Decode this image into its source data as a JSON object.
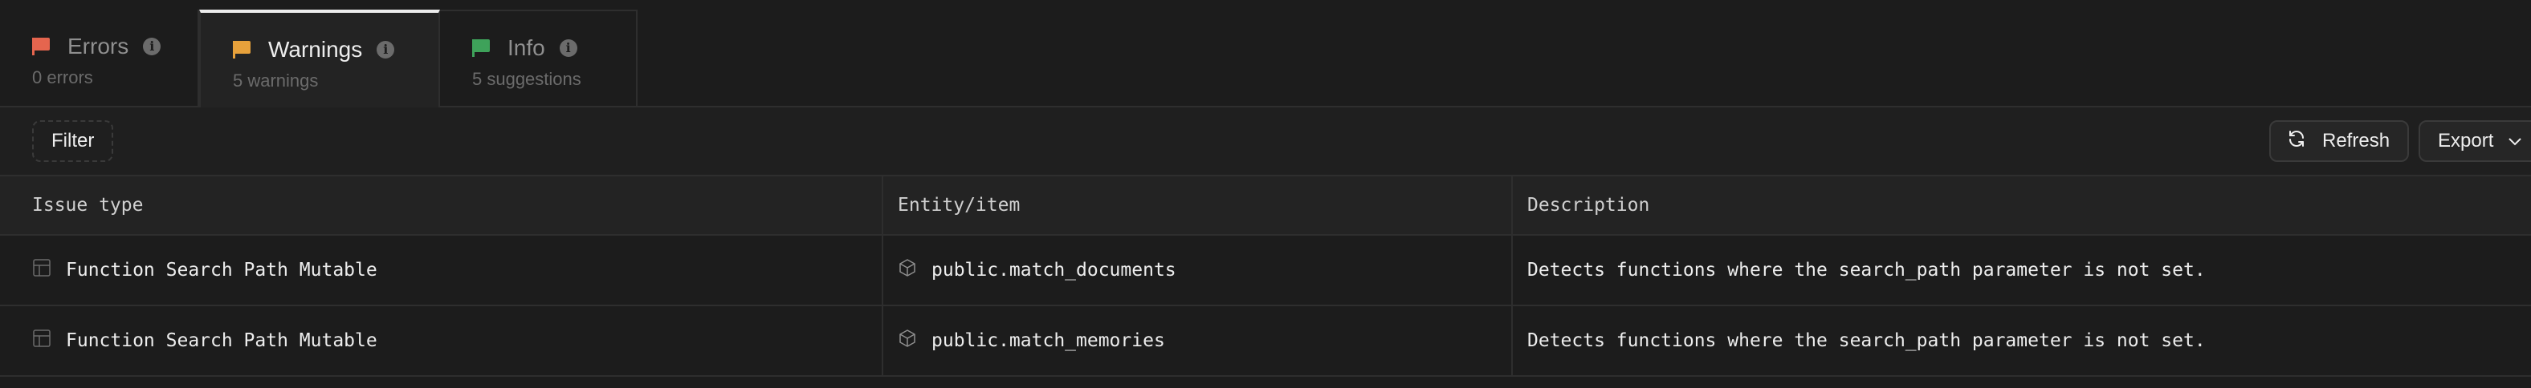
{
  "tabs": [
    {
      "label": "Errors",
      "sub": "0 errors",
      "flag_color": "#e5654e",
      "icon": "flag-icon"
    },
    {
      "label": "Warnings",
      "sub": "5 warnings",
      "flag_color": "#e7a13b",
      "icon": "flag-icon"
    },
    {
      "label": "Info",
      "sub": "5 suggestions",
      "flag_color": "#3ea25a",
      "icon": "flag-icon"
    }
  ],
  "toolbar": {
    "filter_label": "Filter",
    "refresh_label": "Refresh",
    "export_label": "Export"
  },
  "table": {
    "columns": [
      "Issue type",
      "Entity/item",
      "Description"
    ],
    "rows": [
      {
        "issue_type": "Function Search Path Mutable",
        "entity": "public.match_documents",
        "description": "Detects functions where the search_path parameter is not set."
      },
      {
        "issue_type": "Function Search Path Mutable",
        "entity": "public.match_memories",
        "description": "Detects functions where the search_path parameter is not set."
      }
    ]
  }
}
